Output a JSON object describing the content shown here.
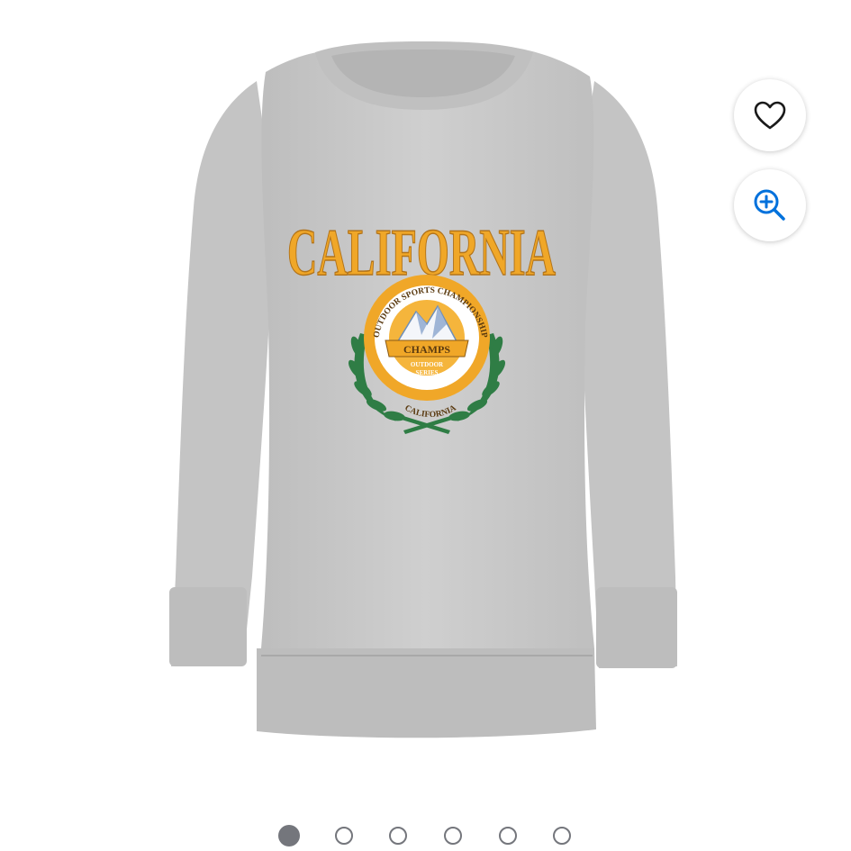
{
  "product": {
    "image_alt": "Gray crewneck sweatshirt with CALIFORNIA graphic",
    "graphic": {
      "headline": "CALIFORNIA",
      "badge_ring_top": "OUTDOOR SPORTS CHAMPIONSHIP",
      "banner": "CHAMPS",
      "sub1": "OUTDOOR",
      "sub2": "SERIES",
      "badge_ring_bottom": "CALIFORNIA"
    }
  },
  "actions": {
    "favorite_icon": "heart-icon",
    "zoom_icon": "zoom-in-icon"
  },
  "carousel": {
    "total": 6,
    "active_index": 0
  },
  "colors": {
    "sweater": "#c8c8c8",
    "graphic_gold": "#f0a728",
    "laurel": "#2f7d45",
    "dot": "#74767c",
    "zoom_icon": "#0071dc"
  }
}
